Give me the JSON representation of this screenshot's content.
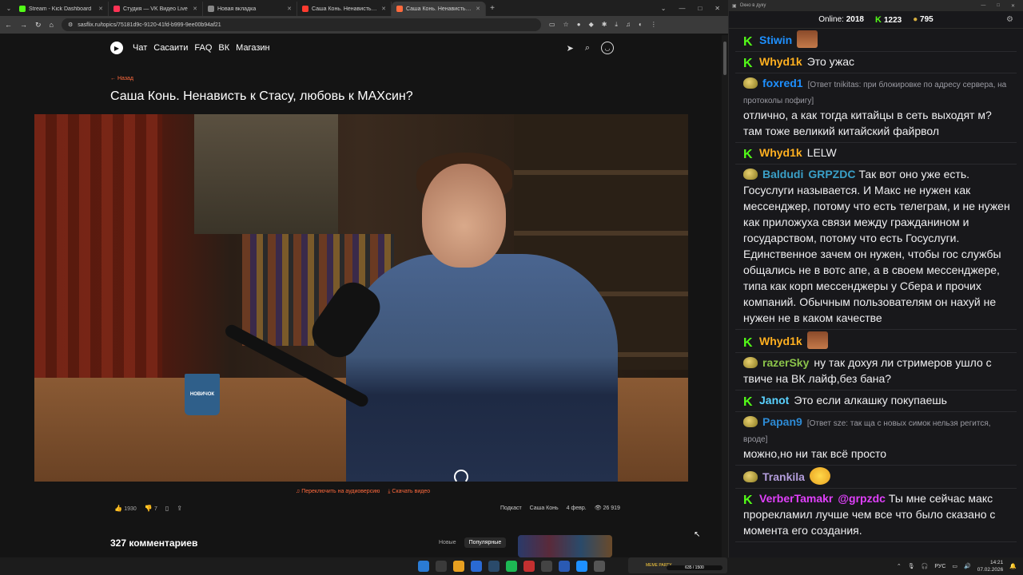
{
  "browser": {
    "tabs": [
      {
        "title": "Stream - Kick Dashboard",
        "color": "#53fc18",
        "active": false
      },
      {
        "title": "Студия — VK Видео Live",
        "color": "#ff3355",
        "active": false
      },
      {
        "title": "Новая вкладка",
        "color": "#888888",
        "active": false
      },
      {
        "title": "Саша Конь. Ненависть к Стасу",
        "color": "#ff3b2f",
        "active": false
      },
      {
        "title": "Саша Конь. Ненависть к С",
        "color": "#ff6a3d",
        "active": true
      }
    ],
    "address": "sasflix.ru/topics/75181d9c-9120-41fd-b999-9ee00b94af21"
  },
  "site": {
    "nav": [
      "Чат",
      "Сасаити",
      "FAQ",
      "ВК",
      "Магазин"
    ],
    "back_label": "← Назад",
    "video_title": "Саша Конь. Ненависть к Стасу, любовь к МАХсин?",
    "mug_text": "НОВИЧОК",
    "audio_link": "Переключить на аудиоверсию",
    "download_link": "Скачать видео",
    "likes": "1930",
    "dislikes": "7",
    "tag_podcast": "Подкаст",
    "tag_guest": "Саша Конь",
    "date": "4 февр.",
    "views": "26 919",
    "comments_title": "327 комментариев",
    "sort_new": "Новые",
    "sort_popular": "Популярные"
  },
  "chat": {
    "window_title": "Окно в дуку",
    "online_label": "Online:",
    "online_value": "2018",
    "kick_count": "1223",
    "coin_count": "795",
    "messages": [
      {
        "badge": "k",
        "nick": "Stiwin",
        "color": "#1e90ff",
        "text": "",
        "emote": "face"
      },
      {
        "badge": "k",
        "nick": "Whyd1k",
        "color": "#ffb020",
        "text": "Это ужас"
      },
      {
        "badge": "b",
        "nick": "foxred1",
        "color": "#1e90ff",
        "reply": "[Ответ tnikitas: при блокировке по адресу сервера, на протоколы пофигу]",
        "text": "отлично, а как тогда китайцы в сеть выходят м? там тоже великий китайский файрвол"
      },
      {
        "badge": "k",
        "nick": "Whyd1k",
        "color": "#ffb020",
        "text": "LELW"
      },
      {
        "badge": "b",
        "nick": "Baldudi",
        "color": "#3aa0c8",
        "mention": "GRPZDC",
        "text": "Так вот оно уже есть. Госуслуги называется. И Макс не нужен как мессенджер, потому что есть телеграм, и не нужен как приложуха связи между гражданином и государством, потому что есть Госуслуги. Единственное зачем он нужен, чтобы гос службы общались не в вотс апе, а в своем мессенджере, типа как корп мессенджеры у Сбера и прочих компаний. Обычным пользователям он нахуй не нужен не в каком качестве"
      },
      {
        "badge": "k",
        "nick": "Whyd1k",
        "color": "#ffb020",
        "text": "",
        "emote": "face"
      },
      {
        "badge": "b",
        "nick": "razerSky",
        "color": "#8bc34a",
        "text": "ну так дохуя ли стримеров ушло с твиче на ВК лайф,без бана?"
      },
      {
        "badge": "k",
        "nick": "Janot",
        "color": "#5ad2ff",
        "text": "Это если алкашку покупаешь"
      },
      {
        "badge": "b",
        "nick": "Papan9",
        "color": "#2d8ad4",
        "reply": "[Ответ sze: так ща с новых симок нельзя регится, вроде]",
        "text": "можно,но ни так всё просто"
      },
      {
        "badge": "b",
        "nick": "Trankila",
        "color": "#b39ddb",
        "text": "",
        "emote": "lol"
      },
      {
        "badge": "k",
        "nick": "VerberTamakr",
        "color": "#e040fb",
        "mention": "@grpzdc",
        "text": "Ты мне сейчас макс прорекламил лучше чем все что было сказано с момента его создания."
      }
    ]
  },
  "taskbar": {
    "meme_label": "MEME PARTY",
    "meme_progress": "635 / 1500",
    "lang": "РУС",
    "time": "14:21",
    "date": "07.02.2026"
  }
}
